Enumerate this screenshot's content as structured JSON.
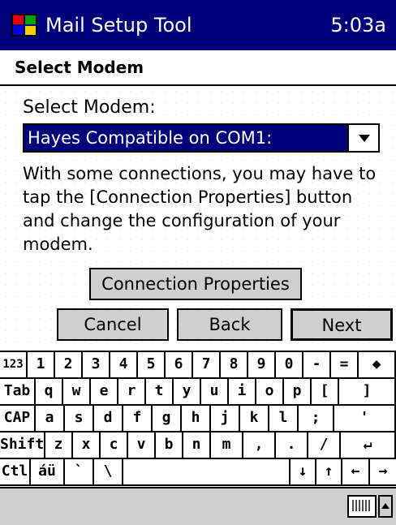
{
  "title_bar": {
    "app_name": "Mail Setup Tool",
    "time": "5:03a",
    "logo_icon": "windows-flag-icon"
  },
  "header": {
    "title": "Select Modem"
  },
  "modem": {
    "label": "Select Modem:",
    "selected": "Hayes Compatible on COM1:"
  },
  "info_text": "With some connections, you may have to tap the [Connection Properties] button and change the configuration of your modem.",
  "buttons": {
    "connection_properties": "Connection Properties",
    "cancel": "Cancel",
    "back": "Back",
    "next": "Next"
  },
  "keyboard": {
    "rows": [
      [
        "123",
        "1",
        "2",
        "3",
        "4",
        "5",
        "6",
        "7",
        "8",
        "9",
        "0",
        "-",
        "=",
        "◆"
      ],
      [
        "Tab",
        "q",
        "w",
        "e",
        "r",
        "t",
        "y",
        "u",
        "i",
        "o",
        "p",
        "[",
        "]"
      ],
      [
        "CAP",
        "a",
        "s",
        "d",
        "f",
        "g",
        "h",
        "j",
        "k",
        "l",
        ";",
        "'"
      ],
      [
        "Shift",
        "z",
        "x",
        "c",
        "v",
        "b",
        "n",
        "m",
        ",",
        ".",
        "/",
        "↵"
      ],
      [
        "Ctl",
        "áü",
        "`",
        "\\",
        "",
        "↓",
        "↑",
        "←",
        "→"
      ]
    ]
  },
  "colors": {
    "title_bar": "#00007b",
    "selection": "#00007b",
    "button_face": "#cfcfcf"
  }
}
